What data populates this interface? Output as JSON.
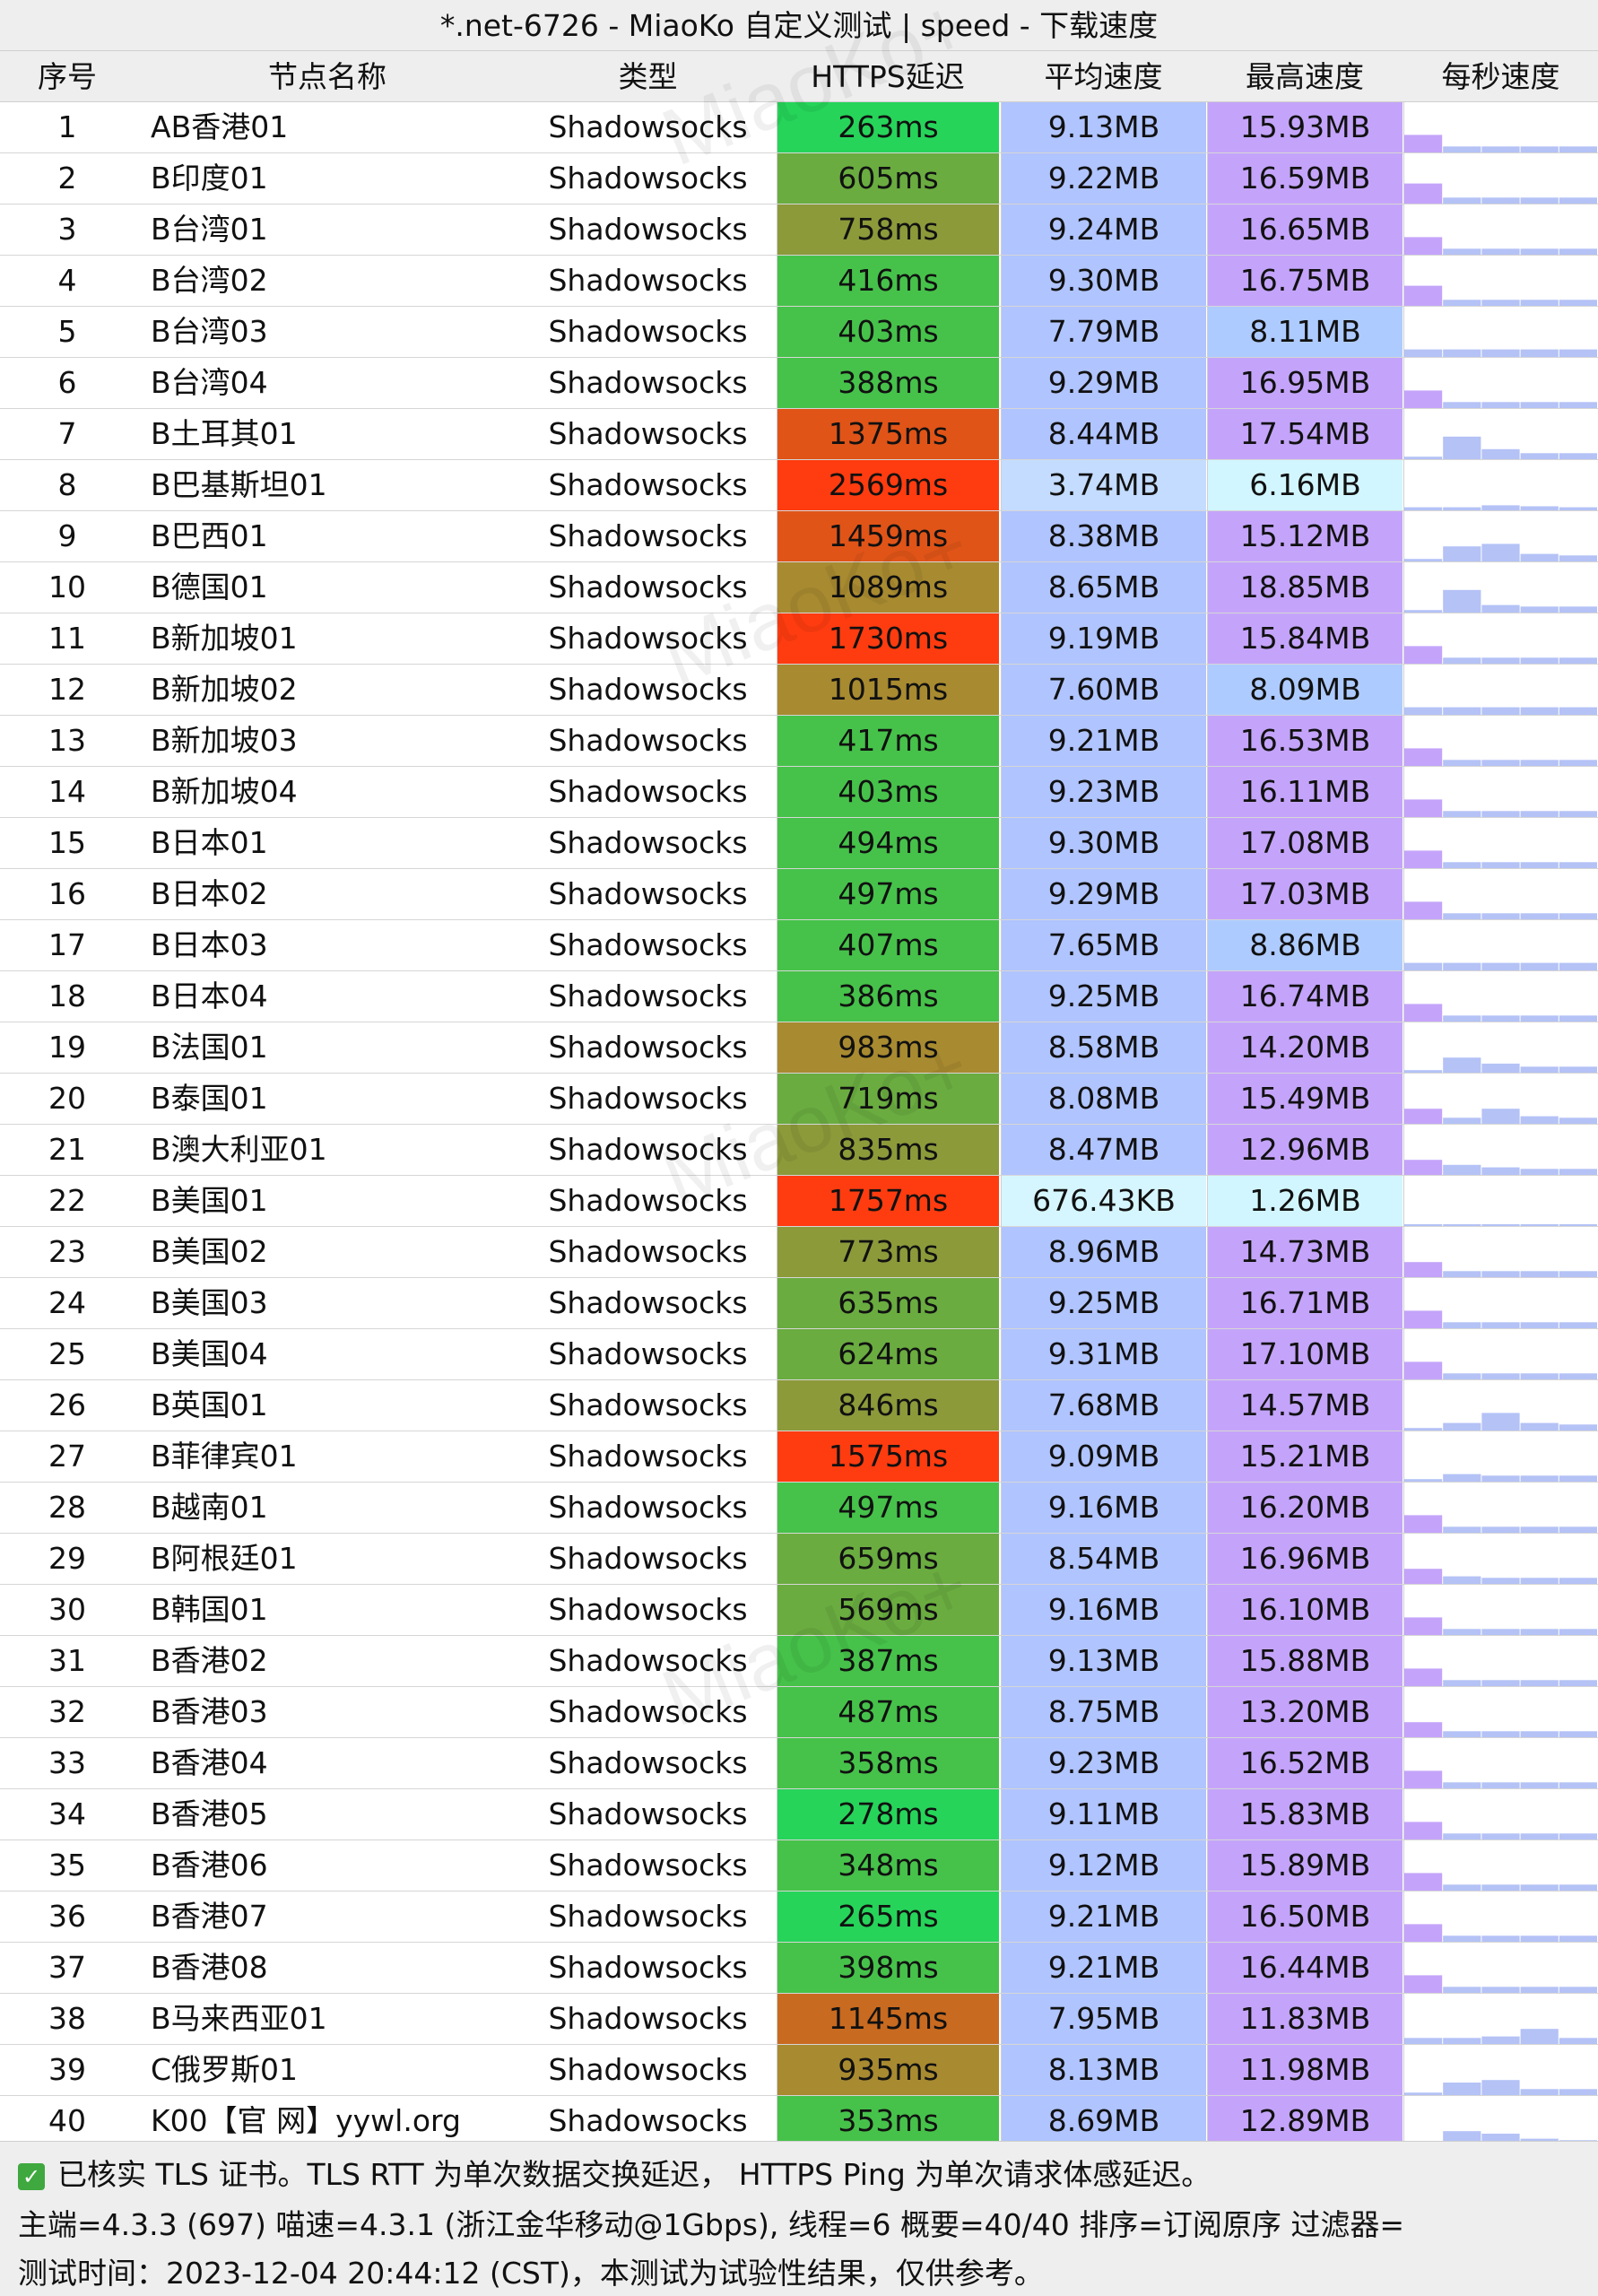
{
  "title": "*.net-6726 - MiaoKo 自定义测试 | speed - 下载速度",
  "watermark": "MiaoKo+",
  "headers": {
    "index": "序号",
    "name": "节点名称",
    "type": "类型",
    "latency": "HTTPS延迟",
    "avg_speed": "平均速度",
    "max_speed": "最高速度",
    "per_second": "每秒速度"
  },
  "colors": {
    "latency_fast": "#26d45a",
    "latency_good": "#46c24a",
    "latency_ok": "#6aac40",
    "latency_mid": "#8c9a3a",
    "latency_slow": "#a88a30",
    "latency_bad": "#e05418",
    "latency_worst": "#ff3c10",
    "speed_high": "#b0c4ff",
    "speed_low": "#c4dcff",
    "speed_min": "#d6f6ff",
    "max_high": "#c4a4fa",
    "max_low": "#aecbff",
    "max_min": "#d2f6ff",
    "sparkline": "#b4c2f6"
  },
  "rows": [
    {
      "index": "1",
      "name": "AB香港01",
      "type": "Shadowsocks",
      "latency": "263ms",
      "latency_color": "#26d45a",
      "avg_speed": "9.13MB",
      "avg_color": "#b0c4ff",
      "max_speed": "15.93MB",
      "max_color": "#c4a4fa",
      "speed_profile": [
        0.35,
        0.12,
        0.12,
        0.12,
        0.12
      ]
    },
    {
      "index": "2",
      "name": "B印度01",
      "type": "Shadowsocks",
      "latency": "605ms",
      "latency_color": "#6aac40",
      "avg_speed": "9.22MB",
      "avg_color": "#b0c4ff",
      "max_speed": "16.59MB",
      "max_color": "#c4a4fa",
      "speed_profile": [
        0.4,
        0.12,
        0.12,
        0.12,
        0.12
      ]
    },
    {
      "index": "3",
      "name": "B台湾01",
      "type": "Shadowsocks",
      "latency": "758ms",
      "latency_color": "#8c9a3a",
      "avg_speed": "9.24MB",
      "avg_color": "#b0c4ff",
      "max_speed": "16.65MB",
      "max_color": "#c4a4fa",
      "speed_profile": [
        0.35,
        0.12,
        0.12,
        0.12,
        0.12
      ]
    },
    {
      "index": "4",
      "name": "B台湾02",
      "type": "Shadowsocks",
      "latency": "416ms",
      "latency_color": "#46c24a",
      "avg_speed": "9.30MB",
      "avg_color": "#b0c4ff",
      "max_speed": "16.75MB",
      "max_color": "#c4a4fa",
      "speed_profile": [
        0.4,
        0.12,
        0.12,
        0.12,
        0.12
      ]
    },
    {
      "index": "5",
      "name": "B台湾03",
      "type": "Shadowsocks",
      "latency": "403ms",
      "latency_color": "#46c24a",
      "avg_speed": "7.79MB",
      "avg_color": "#b0c4ff",
      "max_speed": "8.11MB",
      "max_color": "#aecbff",
      "speed_profile": [
        0.15,
        0.15,
        0.15,
        0.15,
        0.15
      ]
    },
    {
      "index": "6",
      "name": "B台湾04",
      "type": "Shadowsocks",
      "latency": "388ms",
      "latency_color": "#46c24a",
      "avg_speed": "9.29MB",
      "avg_color": "#b0c4ff",
      "max_speed": "16.95MB",
      "max_color": "#c4a4fa",
      "speed_profile": [
        0.35,
        0.12,
        0.12,
        0.12,
        0.12
      ]
    },
    {
      "index": "7",
      "name": "B土耳其01",
      "type": "Shadowsocks",
      "latency": "1375ms",
      "latency_color": "#e05418",
      "avg_speed": "8.44MB",
      "avg_color": "#b0c4ff",
      "max_speed": "17.54MB",
      "max_color": "#c4a4fa",
      "speed_profile": [
        0.05,
        0.45,
        0.2,
        0.12,
        0.12
      ]
    },
    {
      "index": "8",
      "name": "B巴基斯坦01",
      "type": "Shadowsocks",
      "latency": "2569ms",
      "latency_color": "#ff3c10",
      "avg_speed": "3.74MB",
      "avg_color": "#c4dcff",
      "max_speed": "6.16MB",
      "max_color": "#d2f6ff",
      "speed_profile": [
        0.06,
        0.06,
        0.1,
        0.08,
        0.06
      ]
    },
    {
      "index": "9",
      "name": "B巴西01",
      "type": "Shadowsocks",
      "latency": "1459ms",
      "latency_color": "#e05418",
      "avg_speed": "8.38MB",
      "avg_color": "#b0c4ff",
      "max_speed": "15.12MB",
      "max_color": "#c4a4fa",
      "speed_profile": [
        0.05,
        0.3,
        0.35,
        0.15,
        0.12
      ]
    },
    {
      "index": "10",
      "name": "B德国01",
      "type": "Shadowsocks",
      "latency": "1089ms",
      "latency_color": "#a88a30",
      "avg_speed": "8.65MB",
      "avg_color": "#b0c4ff",
      "max_speed": "18.85MB",
      "max_color": "#c4a4fa",
      "speed_profile": [
        0.05,
        0.45,
        0.15,
        0.12,
        0.12
      ]
    },
    {
      "index": "11",
      "name": "B新加坡01",
      "type": "Shadowsocks",
      "latency": "1730ms",
      "latency_color": "#ff3c10",
      "avg_speed": "9.19MB",
      "avg_color": "#b0c4ff",
      "max_speed": "15.84MB",
      "max_color": "#c4a4fa",
      "speed_profile": [
        0.35,
        0.12,
        0.12,
        0.12,
        0.12
      ]
    },
    {
      "index": "12",
      "name": "B新加坡02",
      "type": "Shadowsocks",
      "latency": "1015ms",
      "latency_color": "#a88a30",
      "avg_speed": "7.60MB",
      "avg_color": "#b0c4ff",
      "max_speed": "8.09MB",
      "max_color": "#aecbff",
      "speed_profile": [
        0.15,
        0.15,
        0.15,
        0.15,
        0.15
      ]
    },
    {
      "index": "13",
      "name": "B新加坡03",
      "type": "Shadowsocks",
      "latency": "417ms",
      "latency_color": "#46c24a",
      "avg_speed": "9.21MB",
      "avg_color": "#b0c4ff",
      "max_speed": "16.53MB",
      "max_color": "#c4a4fa",
      "speed_profile": [
        0.35,
        0.12,
        0.12,
        0.12,
        0.12
      ]
    },
    {
      "index": "14",
      "name": "B新加坡04",
      "type": "Shadowsocks",
      "latency": "403ms",
      "latency_color": "#46c24a",
      "avg_speed": "9.23MB",
      "avg_color": "#b0c4ff",
      "max_speed": "16.11MB",
      "max_color": "#c4a4fa",
      "speed_profile": [
        0.35,
        0.12,
        0.12,
        0.12,
        0.12
      ]
    },
    {
      "index": "15",
      "name": "B日本01",
      "type": "Shadowsocks",
      "latency": "494ms",
      "latency_color": "#46c24a",
      "avg_speed": "9.30MB",
      "avg_color": "#b0c4ff",
      "max_speed": "17.08MB",
      "max_color": "#c4a4fa",
      "speed_profile": [
        0.35,
        0.12,
        0.12,
        0.12,
        0.12
      ]
    },
    {
      "index": "16",
      "name": "B日本02",
      "type": "Shadowsocks",
      "latency": "497ms",
      "latency_color": "#46c24a",
      "avg_speed": "9.29MB",
      "avg_color": "#b0c4ff",
      "max_speed": "17.03MB",
      "max_color": "#c4a4fa",
      "speed_profile": [
        0.35,
        0.12,
        0.12,
        0.12,
        0.12
      ]
    },
    {
      "index": "17",
      "name": "B日本03",
      "type": "Shadowsocks",
      "latency": "407ms",
      "latency_color": "#46c24a",
      "avg_speed": "7.65MB",
      "avg_color": "#b0c4ff",
      "max_speed": "8.86MB",
      "max_color": "#aecbff",
      "speed_profile": [
        0.15,
        0.15,
        0.15,
        0.15,
        0.15
      ]
    },
    {
      "index": "18",
      "name": "B日本04",
      "type": "Shadowsocks",
      "latency": "386ms",
      "latency_color": "#46c24a",
      "avg_speed": "9.25MB",
      "avg_color": "#b0c4ff",
      "max_speed": "16.74MB",
      "max_color": "#c4a4fa",
      "speed_profile": [
        0.35,
        0.12,
        0.12,
        0.12,
        0.12
      ]
    },
    {
      "index": "19",
      "name": "B法国01",
      "type": "Shadowsocks",
      "latency": "983ms",
      "latency_color": "#a88a30",
      "avg_speed": "8.58MB",
      "avg_color": "#b0c4ff",
      "max_speed": "14.20MB",
      "max_color": "#c4a4fa",
      "speed_profile": [
        0.05,
        0.3,
        0.18,
        0.12,
        0.12
      ]
    },
    {
      "index": "20",
      "name": "B泰国01",
      "type": "Shadowsocks",
      "latency": "719ms",
      "latency_color": "#6aac40",
      "avg_speed": "8.08MB",
      "avg_color": "#b0c4ff",
      "max_speed": "15.49MB",
      "max_color": "#c4a4fa",
      "speed_profile": [
        0.3,
        0.12,
        0.3,
        0.15,
        0.12
      ]
    },
    {
      "index": "21",
      "name": "B澳大利亚01",
      "type": "Shadowsocks",
      "latency": "835ms",
      "latency_color": "#8c9a3a",
      "avg_speed": "8.47MB",
      "avg_color": "#b0c4ff",
      "max_speed": "12.96MB",
      "max_color": "#c4a4fa",
      "speed_profile": [
        0.3,
        0.2,
        0.15,
        0.12,
        0.12
      ]
    },
    {
      "index": "22",
      "name": "B美国01",
      "type": "Shadowsocks",
      "latency": "1757ms",
      "latency_color": "#ff3c10",
      "avg_speed": "676.43KB",
      "avg_color": "#d6f6ff",
      "max_speed": "1.26MB",
      "max_color": "#d2f6ff",
      "speed_profile": [
        0.02,
        0.02,
        0.02,
        0.02,
        0.02
      ]
    },
    {
      "index": "23",
      "name": "B美国02",
      "type": "Shadowsocks",
      "latency": "773ms",
      "latency_color": "#8c9a3a",
      "avg_speed": "8.96MB",
      "avg_color": "#b0c4ff",
      "max_speed": "14.73MB",
      "max_color": "#c4a4fa",
      "speed_profile": [
        0.3,
        0.12,
        0.12,
        0.12,
        0.12
      ]
    },
    {
      "index": "24",
      "name": "B美国03",
      "type": "Shadowsocks",
      "latency": "635ms",
      "latency_color": "#6aac40",
      "avg_speed": "9.25MB",
      "avg_color": "#b0c4ff",
      "max_speed": "16.71MB",
      "max_color": "#c4a4fa",
      "speed_profile": [
        0.35,
        0.12,
        0.12,
        0.12,
        0.12
      ]
    },
    {
      "index": "25",
      "name": "B美国04",
      "type": "Shadowsocks",
      "latency": "624ms",
      "latency_color": "#6aac40",
      "avg_speed": "9.31MB",
      "avg_color": "#b0c4ff",
      "max_speed": "17.10MB",
      "max_color": "#c4a4fa",
      "speed_profile": [
        0.35,
        0.12,
        0.12,
        0.12,
        0.12
      ]
    },
    {
      "index": "26",
      "name": "B英国01",
      "type": "Shadowsocks",
      "latency": "846ms",
      "latency_color": "#8c9a3a",
      "avg_speed": "7.68MB",
      "avg_color": "#b0c4ff",
      "max_speed": "14.57MB",
      "max_color": "#c4a4fa",
      "speed_profile": [
        0.05,
        0.15,
        0.35,
        0.15,
        0.12
      ]
    },
    {
      "index": "27",
      "name": "B菲律宾01",
      "type": "Shadowsocks",
      "latency": "1575ms",
      "latency_color": "#ff3c10",
      "avg_speed": "9.09MB",
      "avg_color": "#b0c4ff",
      "max_speed": "15.21MB",
      "max_color": "#c4a4fa",
      "speed_profile": [
        0.05,
        0.15,
        0.12,
        0.12,
        0.12
      ]
    },
    {
      "index": "28",
      "name": "B越南01",
      "type": "Shadowsocks",
      "latency": "497ms",
      "latency_color": "#46c24a",
      "avg_speed": "9.16MB",
      "avg_color": "#b0c4ff",
      "max_speed": "16.20MB",
      "max_color": "#c4a4fa",
      "speed_profile": [
        0.35,
        0.12,
        0.12,
        0.12,
        0.12
      ]
    },
    {
      "index": "29",
      "name": "B阿根廷01",
      "type": "Shadowsocks",
      "latency": "659ms",
      "latency_color": "#6aac40",
      "avg_speed": "8.54MB",
      "avg_color": "#b0c4ff",
      "max_speed": "16.96MB",
      "max_color": "#c4a4fa",
      "speed_profile": [
        0.3,
        0.15,
        0.12,
        0.12,
        0.12
      ]
    },
    {
      "index": "30",
      "name": "B韩国01",
      "type": "Shadowsocks",
      "latency": "569ms",
      "latency_color": "#6aac40",
      "avg_speed": "9.16MB",
      "avg_color": "#b0c4ff",
      "max_speed": "16.10MB",
      "max_color": "#c4a4fa",
      "speed_profile": [
        0.35,
        0.12,
        0.12,
        0.12,
        0.12
      ]
    },
    {
      "index": "31",
      "name": "B香港02",
      "type": "Shadowsocks",
      "latency": "387ms",
      "latency_color": "#46c24a",
      "avg_speed": "9.13MB",
      "avg_color": "#b0c4ff",
      "max_speed": "15.88MB",
      "max_color": "#c4a4fa",
      "speed_profile": [
        0.35,
        0.12,
        0.12,
        0.12,
        0.12
      ]
    },
    {
      "index": "32",
      "name": "B香港03",
      "type": "Shadowsocks",
      "latency": "487ms",
      "latency_color": "#46c24a",
      "avg_speed": "8.75MB",
      "avg_color": "#b0c4ff",
      "max_speed": "13.20MB",
      "max_color": "#c4a4fa",
      "speed_profile": [
        0.3,
        0.12,
        0.12,
        0.12,
        0.12
      ]
    },
    {
      "index": "33",
      "name": "B香港04",
      "type": "Shadowsocks",
      "latency": "358ms",
      "latency_color": "#46c24a",
      "avg_speed": "9.23MB",
      "avg_color": "#b0c4ff",
      "max_speed": "16.52MB",
      "max_color": "#c4a4fa",
      "speed_profile": [
        0.35,
        0.12,
        0.12,
        0.12,
        0.12
      ]
    },
    {
      "index": "34",
      "name": "B香港05",
      "type": "Shadowsocks",
      "latency": "278ms",
      "latency_color": "#26d45a",
      "avg_speed": "9.11MB",
      "avg_color": "#b0c4ff",
      "max_speed": "15.83MB",
      "max_color": "#c4a4fa",
      "speed_profile": [
        0.35,
        0.12,
        0.12,
        0.12,
        0.12
      ]
    },
    {
      "index": "35",
      "name": "B香港06",
      "type": "Shadowsocks",
      "latency": "348ms",
      "latency_color": "#46c24a",
      "avg_speed": "9.12MB",
      "avg_color": "#b0c4ff",
      "max_speed": "15.89MB",
      "max_color": "#c4a4fa",
      "speed_profile": [
        0.35,
        0.12,
        0.12,
        0.12,
        0.12
      ]
    },
    {
      "index": "36",
      "name": "B香港07",
      "type": "Shadowsocks",
      "latency": "265ms",
      "latency_color": "#26d45a",
      "avg_speed": "9.21MB",
      "avg_color": "#b0c4ff",
      "max_speed": "16.50MB",
      "max_color": "#c4a4fa",
      "speed_profile": [
        0.35,
        0.12,
        0.12,
        0.12,
        0.12
      ]
    },
    {
      "index": "37",
      "name": "B香港08",
      "type": "Shadowsocks",
      "latency": "398ms",
      "latency_color": "#46c24a",
      "avg_speed": "9.21MB",
      "avg_color": "#b0c4ff",
      "max_speed": "16.44MB",
      "max_color": "#c4a4fa",
      "speed_profile": [
        0.35,
        0.12,
        0.12,
        0.12,
        0.12
      ]
    },
    {
      "index": "38",
      "name": "B马来西亚01",
      "type": "Shadowsocks",
      "latency": "1145ms",
      "latency_color": "#c86a20",
      "avg_speed": "7.95MB",
      "avg_color": "#b0c4ff",
      "max_speed": "11.83MB",
      "max_color": "#c4a4fa",
      "speed_profile": [
        0.12,
        0.12,
        0.15,
        0.3,
        0.12
      ]
    },
    {
      "index": "39",
      "name": "C俄罗斯01",
      "type": "Shadowsocks",
      "latency": "935ms",
      "latency_color": "#a88a30",
      "avg_speed": "8.13MB",
      "avg_color": "#b0c4ff",
      "max_speed": "11.98MB",
      "max_color": "#c4a4fa",
      "speed_profile": [
        0.05,
        0.25,
        0.3,
        0.12,
        0.12
      ]
    },
    {
      "index": "40",
      "name": "K00【官 网】yywl.org",
      "type": "Shadowsocks",
      "latency": "353ms",
      "latency_color": "#46c24a",
      "avg_speed": "8.69MB",
      "avg_color": "#b0c4ff",
      "max_speed": "12.89MB",
      "max_color": "#c4a4fa",
      "speed_profile": [
        0.05,
        0.3,
        0.25,
        0.15,
        0.12
      ]
    }
  ],
  "footer": {
    "note": "已核实 TLS 证书。TLS RTT 为单次数据交换延迟， HTTPS Ping 为单次请求体感延迟。",
    "info": "主端=4.3.3 (697) 喵速=4.3.1 (浙江金华移动@1Gbps), 线程=6 概要=40/40 排序=订阅原序 过滤器=",
    "time": "测试时间：2023-12-04 20:44:12 (CST)，本测试为试验性结果，仅供参考。"
  }
}
